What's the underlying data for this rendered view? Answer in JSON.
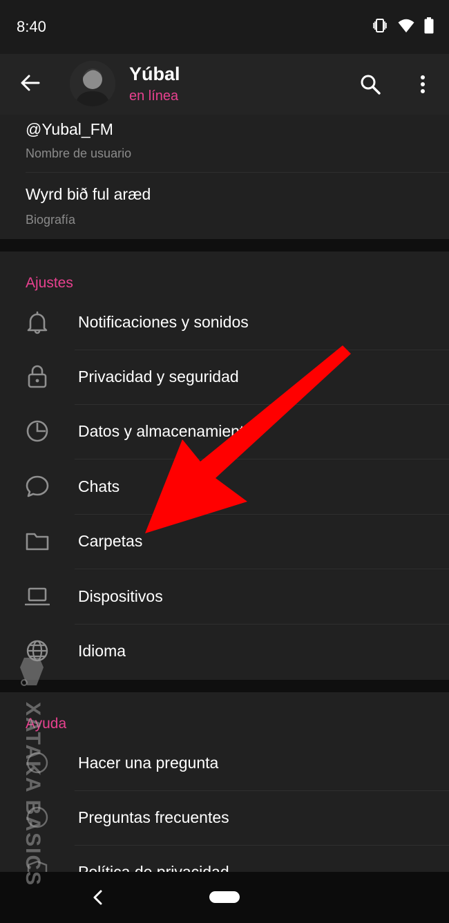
{
  "status_bar": {
    "time": "8:40"
  },
  "header": {
    "name": "Yúbal",
    "status": "en línea"
  },
  "profile": {
    "username_value": "@Yubal_FM",
    "username_label": "Nombre de usuario",
    "bio_value": "Wyrd bið ful aræd",
    "bio_label": "Biografía"
  },
  "settings": {
    "title": "Ajustes",
    "items": [
      {
        "label": "Notificaciones y sonidos",
        "icon": "bell-icon"
      },
      {
        "label": "Privacidad y seguridad",
        "icon": "lock-icon"
      },
      {
        "label": "Datos y almacenamiento",
        "icon": "pie-chart-icon"
      },
      {
        "label": "Chats",
        "icon": "chat-bubble-icon"
      },
      {
        "label": "Carpetas",
        "icon": "folder-icon"
      },
      {
        "label": "Dispositivos",
        "icon": "laptop-icon"
      },
      {
        "label": "Idioma",
        "icon": "globe-icon"
      }
    ]
  },
  "help": {
    "title": "Ayuda",
    "items": [
      {
        "label": "Hacer una pregunta",
        "icon": "question-icon"
      },
      {
        "label": "Preguntas frecuentes",
        "icon": "faq-icon"
      },
      {
        "label": "Política de privacidad",
        "icon": "shield-icon"
      }
    ]
  },
  "watermark": {
    "text": "XATAKA BASICS"
  },
  "colors": {
    "accent": "#e8418f",
    "annotation_arrow": "#ff0000",
    "background": "#212121"
  }
}
